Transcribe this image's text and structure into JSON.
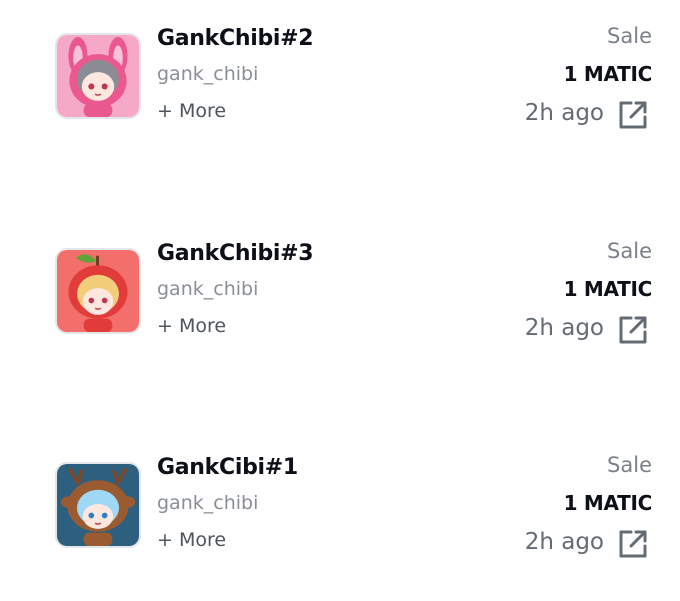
{
  "colors": {
    "name_text": "#0d1117",
    "collection_text": "#8a8f97",
    "more_text": "#4d545c",
    "type_text": "#7b8189",
    "time_text": "#646b73",
    "icon": "#646b73",
    "thumb_border": "#e3e6ea"
  },
  "items": [
    {
      "name": "GankChibi#2",
      "collection": "gank_chibi",
      "more": "+ More",
      "type": "Sale",
      "price": "1 MATIC",
      "time": "2h ago",
      "thumb_bg": "#f6a9c7",
      "thumb_icon": "bunny-chibi-icon",
      "link_icon": "external-link-icon"
    },
    {
      "name": "GankChibi#3",
      "collection": "gank_chibi",
      "more": "+ More",
      "type": "Sale",
      "price": "1 MATIC",
      "time": "2h ago",
      "thumb_bg": "#f26f6c",
      "thumb_icon": "apple-chibi-icon",
      "link_icon": "external-link-icon"
    },
    {
      "name": "GankCibi#1",
      "collection": "gank_chibi",
      "more": "+ More",
      "type": "Sale",
      "price": "1 MATIC",
      "time": "2h ago",
      "thumb_bg": "#2f5f7e",
      "thumb_icon": "reindeer-chibi-icon",
      "link_icon": "external-link-icon"
    }
  ]
}
